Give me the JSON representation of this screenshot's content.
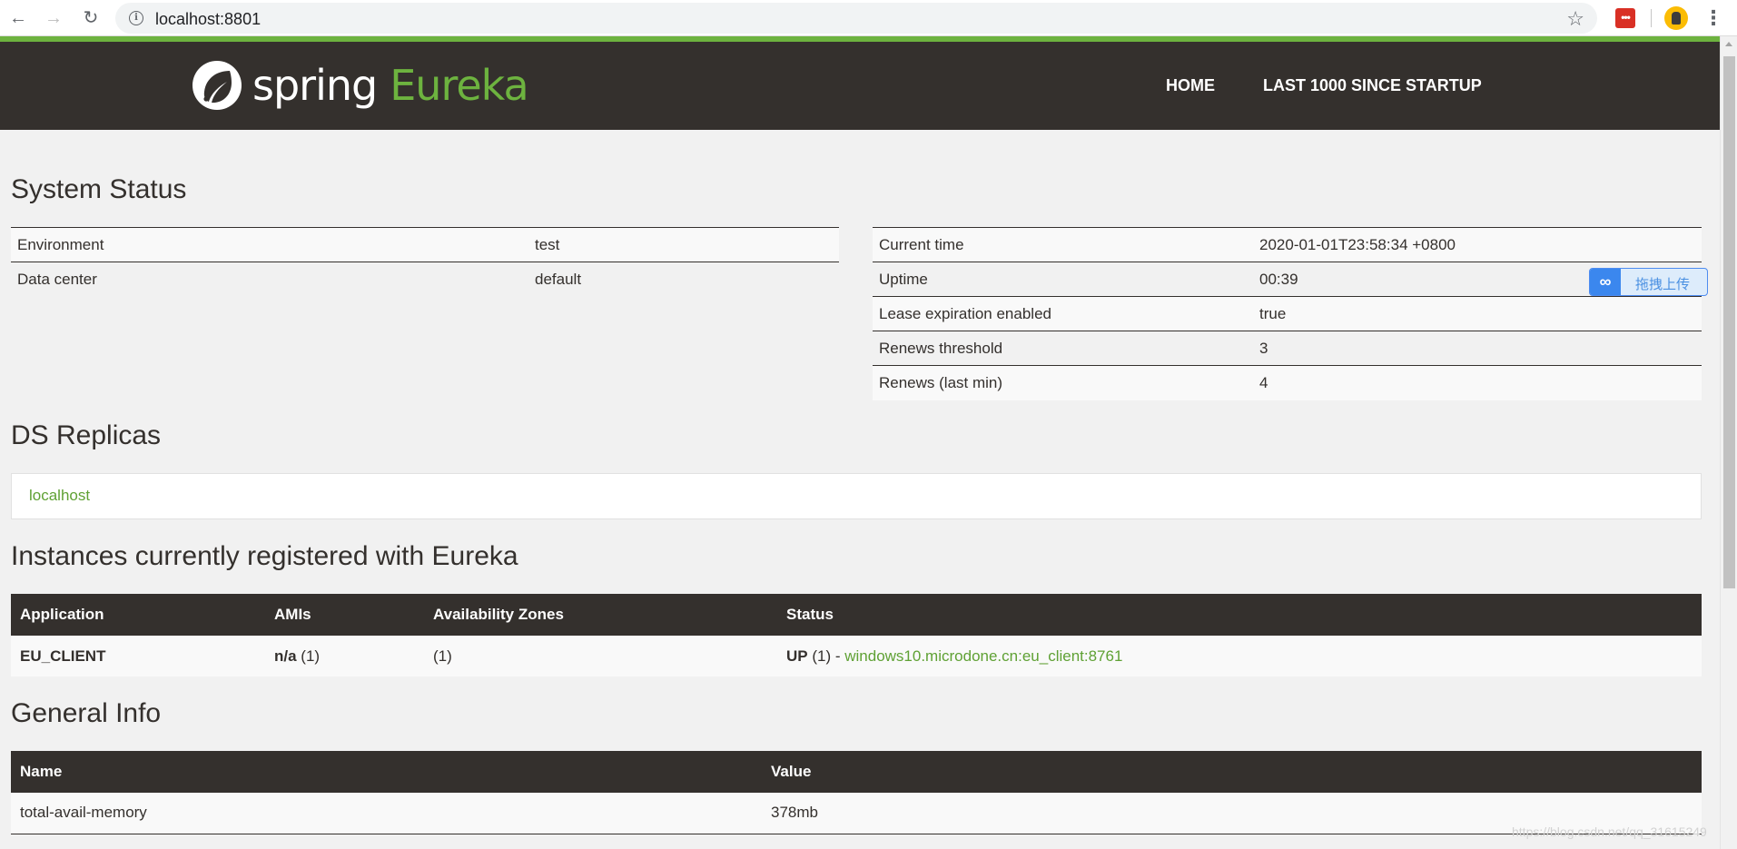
{
  "browser": {
    "url": "localhost:8801",
    "icons": [
      "back-icon",
      "forward-icon",
      "reload-icon",
      "info-icon",
      "star-icon",
      "extension-icon",
      "profile-avatar",
      "menu-kebab-icon"
    ]
  },
  "header": {
    "logo_spring": "spring",
    "logo_eureka": "Eureka",
    "nav": {
      "home": "HOME",
      "last1000": "LAST 1000 SINCE STARTUP"
    }
  },
  "system_status": {
    "title": "System Status",
    "left": [
      {
        "label": "Environment",
        "value": "test"
      },
      {
        "label": "Data center",
        "value": "default"
      }
    ],
    "right": [
      {
        "label": "Current time",
        "value": "2020-01-01T23:58:34 +0800"
      },
      {
        "label": "Uptime",
        "value": "00:39"
      },
      {
        "label": "Lease expiration enabled",
        "value": "true"
      },
      {
        "label": "Renews threshold",
        "value": "3"
      },
      {
        "label": "Renews (last min)",
        "value": "4"
      }
    ]
  },
  "ds_replicas": {
    "title": "DS Replicas",
    "items": [
      "localhost"
    ]
  },
  "instances": {
    "title": "Instances currently registered with Eureka",
    "headers": [
      "Application",
      "AMIs",
      "Availability Zones",
      "Status"
    ],
    "rows": [
      {
        "application": "EU_CLIENT",
        "amis_bold": "n/a",
        "amis_count": " (1)",
        "zones": "(1)",
        "status_bold": "UP",
        "status_count": " (1) - ",
        "status_link": "windows10.microdone.cn:eu_client:8761"
      }
    ]
  },
  "general_info": {
    "title": "General Info",
    "headers": [
      "Name",
      "Value"
    ],
    "rows": [
      {
        "name": "total-avail-memory",
        "value": "378mb"
      }
    ]
  },
  "baidu_widget": {
    "label": "拖拽上传"
  },
  "watermark": "https://blog.csdn.net/qq_31615249",
  "colors": {
    "brand_green": "#6db33f",
    "navbar_dark": "#34302d",
    "link_green": "#5fa134"
  }
}
